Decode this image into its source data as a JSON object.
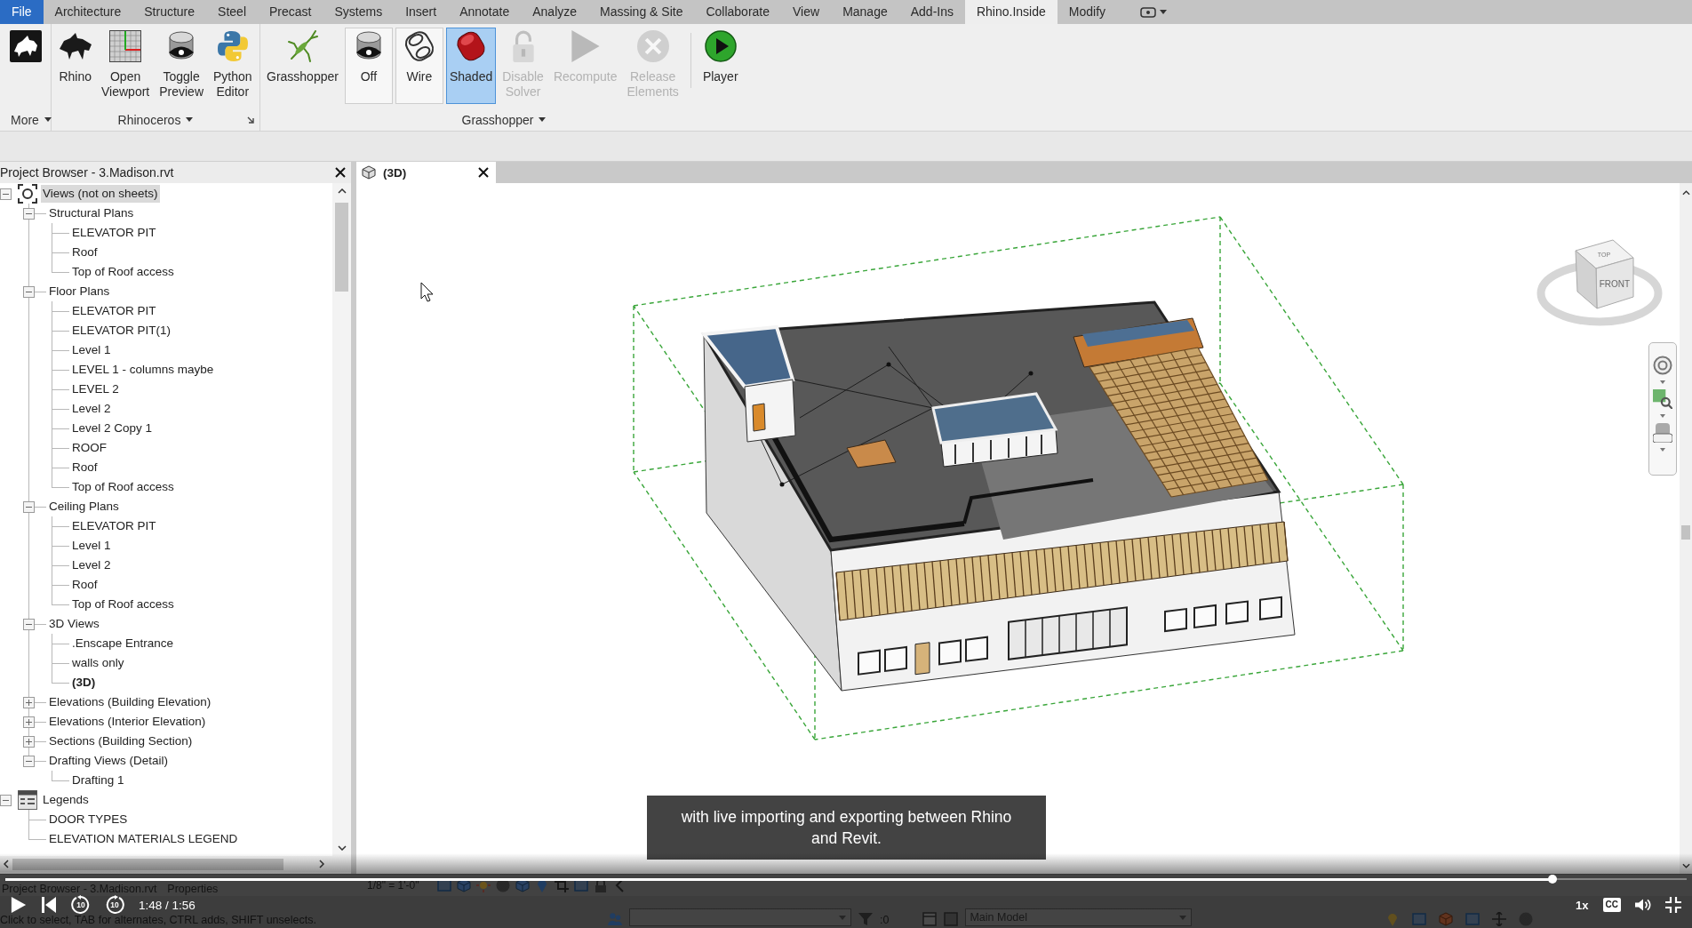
{
  "ribbon_tabs": [
    {
      "label": "File",
      "kind": "application",
      "selected": false
    },
    {
      "label": "Architecture",
      "kind": "tab",
      "selected": false
    },
    {
      "label": "Structure",
      "kind": "tab",
      "selected": false
    },
    {
      "label": "Steel",
      "kind": "tab",
      "selected": false
    },
    {
      "label": "Precast",
      "kind": "tab",
      "selected": false
    },
    {
      "label": "Systems",
      "kind": "tab",
      "selected": false
    },
    {
      "label": "Insert",
      "kind": "tab",
      "selected": false
    },
    {
      "label": "Annotate",
      "kind": "tab",
      "selected": false
    },
    {
      "label": "Analyze",
      "kind": "tab",
      "selected": false
    },
    {
      "label": "Massing & Site",
      "kind": "tab",
      "selected": false
    },
    {
      "label": "Collaborate",
      "kind": "tab",
      "selected": false
    },
    {
      "label": "View",
      "kind": "tab",
      "selected": false
    },
    {
      "label": "Manage",
      "kind": "tab",
      "selected": false
    },
    {
      "label": "Add-Ins",
      "kind": "tab",
      "selected": false
    },
    {
      "label": "Rhino.Inside",
      "kind": "tab",
      "selected": true
    },
    {
      "label": "Modify",
      "kind": "tab",
      "selected": false
    }
  ],
  "ribbon_panels": [
    {
      "title": "More",
      "buttons": [
        {
          "kind": "button",
          "selected": false,
          "disabled": false
        }
      ]
    },
    {
      "title": "Rhinoceros",
      "dialog_launcher": true,
      "buttons": [
        {
          "label": "Rhino",
          "kind": "button",
          "selected": false,
          "disabled": false
        },
        {
          "label": "Open Viewport",
          "kind": "button",
          "selected": false,
          "disabled": false
        },
        {
          "label": "Toggle Preview",
          "kind": "button",
          "selected": false,
          "disabled": false
        },
        {
          "label": "Python Editor",
          "kind": "button",
          "selected": false,
          "disabled": false
        }
      ]
    },
    {
      "title": "Grasshopper",
      "buttons": [
        {
          "label": "Grasshopper",
          "kind": "button",
          "selected": false,
          "disabled": false
        },
        {
          "label": "Off",
          "kind": "toggle",
          "selected": false,
          "disabled": false
        },
        {
          "label": "Wire",
          "kind": "toggle",
          "selected": false,
          "disabled": false
        },
        {
          "label": "Shaded",
          "kind": "toggle",
          "selected": true,
          "disabled": false
        },
        {
          "label": "Disable Solver",
          "kind": "button",
          "selected": false,
          "disabled": true
        },
        {
          "label": "Recompute",
          "kind": "button",
          "selected": false,
          "disabled": true
        },
        {
          "label": "Release Elements",
          "kind": "button",
          "selected": false,
          "disabled": true
        },
        {
          "label": "Player",
          "kind": "button",
          "selected": false,
          "disabled": false,
          "separator_before": true
        }
      ]
    }
  ],
  "project_browser": {
    "title": "Project Browser - 3.Madison.rvt",
    "tree": [
      {
        "label": "Views (not on sheets)",
        "kind": "views",
        "expanded": true,
        "selected": true,
        "current": false,
        "children": [
          {
            "label": "Structural Plans",
            "expanded": true,
            "selected": false,
            "current": false,
            "children": [
              {
                "label": "ELEVATOR PIT",
                "selected": false,
                "current": false
              },
              {
                "label": "Roof",
                "selected": false,
                "current": false
              },
              {
                "label": "Top of Roof access",
                "selected": false,
                "current": false
              }
            ]
          },
          {
            "label": "Floor Plans",
            "expanded": true,
            "selected": false,
            "current": false,
            "children": [
              {
                "label": "ELEVATOR PIT",
                "selected": false,
                "current": false
              },
              {
                "label": "ELEVATOR PIT(1)",
                "selected": false,
                "current": false
              },
              {
                "label": "Level 1",
                "selected": false,
                "current": false
              },
              {
                "label": "LEVEL 1 - columns maybe",
                "selected": false,
                "current": false
              },
              {
                "label": "LEVEL 2",
                "selected": false,
                "current": false
              },
              {
                "label": "Level 2",
                "selected": false,
                "current": false
              },
              {
                "label": "Level 2 Copy 1",
                "selected": false,
                "current": false
              },
              {
                "label": "ROOF",
                "selected": false,
                "current": false
              },
              {
                "label": "Roof",
                "selected": false,
                "current": false
              },
              {
                "label": "Top of Roof access",
                "selected": false,
                "current": false
              }
            ]
          },
          {
            "label": "Ceiling Plans",
            "expanded": true,
            "selected": false,
            "current": false,
            "children": [
              {
                "label": "ELEVATOR PIT",
                "selected": false,
                "current": false
              },
              {
                "label": "Level 1",
                "selected": false,
                "current": false
              },
              {
                "label": "Level 2",
                "selected": false,
                "current": false
              },
              {
                "label": "Roof",
                "selected": false,
                "current": false
              },
              {
                "label": "Top of Roof access",
                "selected": false,
                "current": false
              }
            ]
          },
          {
            "label": "3D Views",
            "expanded": true,
            "selected": false,
            "current": false,
            "children": [
              {
                "label": ".Enscape Entrance",
                "selected": false,
                "current": false
              },
              {
                "label": "walls only",
                "selected": false,
                "current": false
              },
              {
                "label": "(3D)",
                "selected": false,
                "current": true
              }
            ]
          },
          {
            "label": "Elevations (Building Elevation)",
            "expanded": false,
            "selected": false,
            "current": false
          },
          {
            "label": "Elevations (Interior Elevation)",
            "expanded": false,
            "selected": false,
            "current": false
          },
          {
            "label": "Sections (Building Section)",
            "expanded": false,
            "selected": false,
            "current": false
          },
          {
            "label": "Drafting Views (Detail)",
            "expanded": true,
            "selected": false,
            "current": false,
            "children": [
              {
                "label": "Drafting 1",
                "selected": false,
                "current": false
              }
            ]
          }
        ]
      },
      {
        "label": "Legends",
        "kind": "legends",
        "expanded": true,
        "selected": false,
        "current": false,
        "children": [
          {
            "label": "DOOR TYPES",
            "selected": false,
            "current": false
          },
          {
            "label": "ELEVATION MATERIALS LEGEND",
            "selected": false,
            "current": false
          }
        ]
      }
    ]
  },
  "view_tabs": [
    {
      "label": "(3D)",
      "selected": true
    }
  ],
  "view_cube": {
    "top": "TOP",
    "front": "FRONT"
  },
  "caption": "with live importing and exporting between Rhino and Revit.",
  "dock_tabs": [
    "Project Browser - 3.Madison.rvt",
    "Properties"
  ],
  "view_scale": "1/8\" = 1'-0\"",
  "status_bar": {
    "message": "Click to select, TAB for alternates, CTRL adds, SHIFT unselects.",
    "selection_count": ":0",
    "model": "Main Model"
  },
  "video_player": {
    "progress": {
      "level": 0.92
    },
    "time": "1:48 / 1:56",
    "skip_back": "10",
    "skip_forward": "10",
    "speed": "1x",
    "captions": "CC"
  }
}
